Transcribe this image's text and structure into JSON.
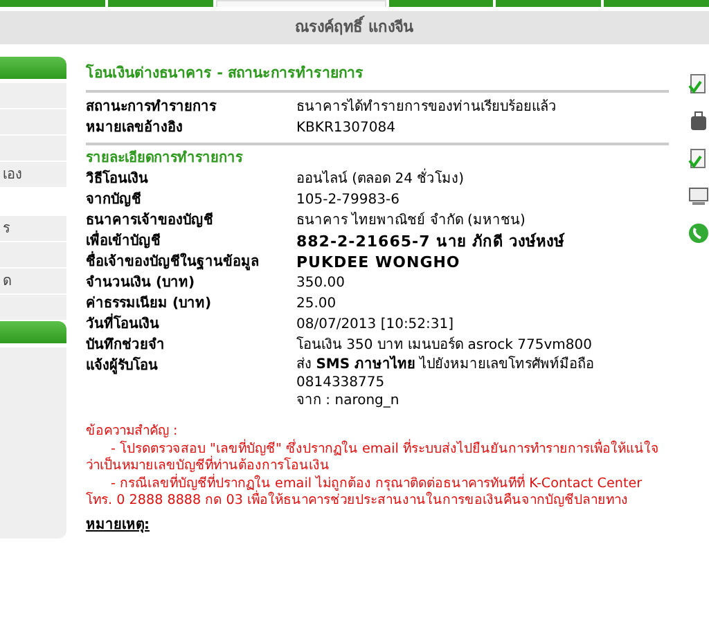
{
  "top_tabs": [
    {
      "selected": false
    },
    {
      "selected": false
    },
    {
      "selected": true
    },
    {
      "selected": false
    },
    {
      "selected": false
    },
    {
      "selected": false
    }
  ],
  "header": {
    "user_name": "ณรงค์ฤทธิ์ แกงจีน"
  },
  "sidebar": [
    {
      "kind": "header"
    },
    {
      "kind": "item"
    },
    {
      "kind": "item"
    },
    {
      "kind": "item"
    },
    {
      "kind": "item",
      "text": "เอง"
    },
    {
      "kind": "blank"
    },
    {
      "kind": "item",
      "text": "ร"
    },
    {
      "kind": "item"
    },
    {
      "kind": "item",
      "text": "ด"
    },
    {
      "kind": "item"
    },
    {
      "kind": "header"
    },
    {
      "kind": "block"
    }
  ],
  "title": "โอนเงินต่างธนาคาร - สถานะการทำรายการ",
  "status_rows": [
    {
      "label": "สถานะการทำรายการ",
      "value": "ธนาคารได้ทำรายการของท่านเรียบร้อยแล้ว"
    },
    {
      "label": "หมายเลขอ้างอิง",
      "value": "KBKR1307084"
    }
  ],
  "details_title": "รายละเอียดการทำรายการ",
  "detail_rows": [
    {
      "label": "วิธีโอนเงิน",
      "value": "ออนไลน์ (ตลอด 24 ชั่วโมง)",
      "bold": false
    },
    {
      "label": "จากบัญชี",
      "value": "105-2-79983-6",
      "bold": false
    },
    {
      "label": "ธนาคารเจ้าของบัญชี",
      "value": "ธนาคาร ไทยพาณิชย์ จำกัด (มหาชน)",
      "bold": false
    },
    {
      "label": "เพื่อเข้าบัญชี",
      "value": "882-2-21665-7 นาย ภักดี วงษ์หงษ์",
      "bold": true
    },
    {
      "label": "ชื่อเจ้าของบัญชีในฐานข้อมูล",
      "value": "PUKDEE WONGHO",
      "bold": true
    },
    {
      "label": "จำนวนเงิน (บาท)",
      "value": "350.00",
      "bold": false
    },
    {
      "label": "ค่าธรรมเนียม (บาท)",
      "value": "25.00",
      "bold": false
    },
    {
      "label": "วันที่โอนเงิน",
      "value": "08/07/2013 [10:52:31]",
      "bold": false
    },
    {
      "label": "บันทึกช่วยจำ",
      "value": "โอนเงิน 350 บาท เมนบอร์ด asrock 775vm800",
      "bold": false
    }
  ],
  "notify": {
    "label": "แจ้งผู้รับโอน",
    "lines": [
      "ส่ง **SMS ภาษาไทย** ไปยังหมายเลขโทรศัพท์มือถือ",
      "0814338775",
      "จาก : narong_n"
    ]
  },
  "notice": {
    "heading": "ข้อความสำคัญ :",
    "items": [
      "- โปรดตรวจสอบ \"เลขที่บัญชี\" ซึ่งปรากฏใน email ที่ระบบส่งไปยืนยันการทำรายการเพื่อให้แน่ใจว่าเป็นหมายเลขบัญชีที่ท่านต้องการโอนเงิน",
      "- กรณีเลขที่บัญชีที่ปรากฏใน email ไม่ถูกต้อง กรุณาติดต่อธนาคารทันทีที่ K-Contact Center โทร. 0 2888 8888 กด 03 เพื่อให้ธนาคารช่วยประสานงานในการขอเงินคืนจากบัญชีปลายทาง"
    ]
  },
  "remark": "หมายเหตุ:",
  "side_icons": [
    {
      "kind": "doc"
    },
    {
      "kind": "bag"
    },
    {
      "kind": "doc"
    },
    {
      "kind": "screen"
    },
    {
      "kind": "phone"
    }
  ]
}
